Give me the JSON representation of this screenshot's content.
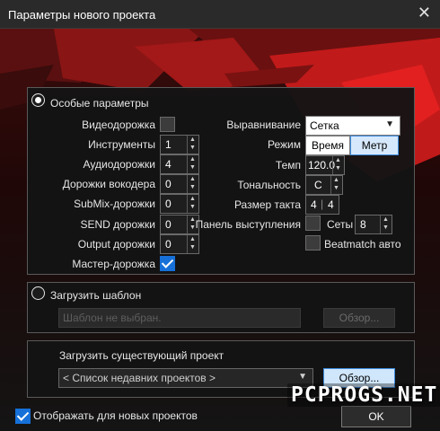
{
  "window": {
    "title": "Параметры нового проекта",
    "close_icon": "close-icon"
  },
  "special": {
    "label": "Особые параметры",
    "left": {
      "video": "Видеодорожка",
      "instruments": {
        "label": "Инструменты",
        "value": "1"
      },
      "audio": {
        "label": "Аудиодорожки",
        "value": "4"
      },
      "vocoder": {
        "label": "Дорожки вокодера",
        "value": "0"
      },
      "submix": {
        "label": "SubMix-дорожки",
        "value": "0"
      },
      "send": {
        "label": "SEND дорожки",
        "value": "0"
      },
      "output": {
        "label": "Output дорожки",
        "value": "0"
      },
      "master": "Мастер-дорожка"
    },
    "right": {
      "align": {
        "label": "Выравнивание",
        "value": "Сетка"
      },
      "mode": {
        "label": "Режим",
        "options": [
          "Время",
          "Метр"
        ]
      },
      "tempo": {
        "label": "Темп",
        "value": "120.0"
      },
      "key": {
        "label": "Тональность",
        "value": "C"
      },
      "meter": {
        "label": "Размер такта",
        "num": "4",
        "den": "4"
      },
      "perf": {
        "label": "Панель выступления"
      },
      "sets": {
        "label": "Сеты",
        "value": "8"
      },
      "beatmatch": "Beatmatch авто"
    }
  },
  "template": {
    "label": "Загрузить шаблон",
    "placeholder": "Шаблон не выбран.",
    "browse": "Обзор..."
  },
  "existing": {
    "label": "Загрузить существующий проект",
    "select": "< Список недавних проектов >",
    "browse": "Обзор..."
  },
  "footer": {
    "show_label": "Отображать для новых проектов",
    "ok": "OK"
  },
  "watermark": "PCPROGS.NET",
  "colors": {
    "accent": "#1670d8",
    "browse_active": "#cfe6fb"
  }
}
